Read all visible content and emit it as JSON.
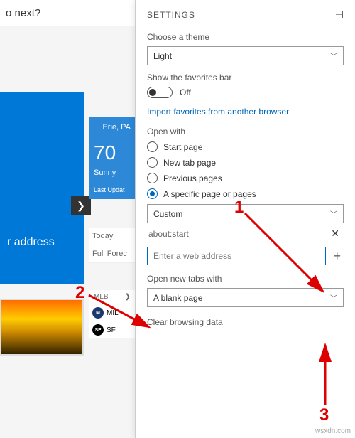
{
  "background": {
    "prompt_text": "o next?",
    "blue_card_text": "r address",
    "weather": {
      "location": "Erie, PA",
      "temp": "70",
      "condition": "Sunny",
      "updated": "Last Updat"
    },
    "side_links": [
      "Today",
      "Full Forec"
    ],
    "mlb": {
      "header": "MLB",
      "teams": [
        {
          "abbr": "MIL",
          "logo": "M"
        },
        {
          "abbr": "SF",
          "logo": "SF"
        }
      ]
    }
  },
  "panel": {
    "title": "SETTINGS",
    "theme": {
      "label": "Choose a theme",
      "value": "Light"
    },
    "favbar": {
      "label": "Show the favorites bar",
      "state": "Off"
    },
    "import_link": "Import favorites from another browser",
    "open_with": {
      "label": "Open with",
      "options": [
        "Start page",
        "New tab page",
        "Previous pages",
        "A specific page or pages"
      ],
      "selected": 3,
      "custom_label": "Custom"
    },
    "pages": {
      "existing": "about:start",
      "input_placeholder": "Enter a web address"
    },
    "new_tabs": {
      "label": "Open new tabs with",
      "value": "A blank page"
    },
    "clear": "Clear browsing data"
  },
  "annotations": {
    "a1": "1",
    "a2": "2",
    "a3": "3"
  },
  "watermark": "wsxdn.com"
}
